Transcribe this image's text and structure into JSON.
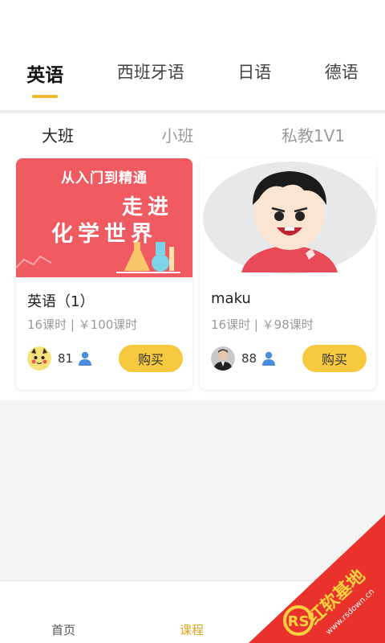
{
  "lang_tabs": [
    {
      "label": "英语",
      "active": true
    },
    {
      "label": "西班牙语",
      "active": false
    },
    {
      "label": "日语",
      "active": false
    },
    {
      "label": "德语",
      "active": false
    }
  ],
  "class_tabs": [
    {
      "label": "大班",
      "active": true
    },
    {
      "label": "小班",
      "active": false
    },
    {
      "label": "私教1V1",
      "active": false
    }
  ],
  "courses": [
    {
      "title": "英语（1）",
      "meta": "16课时 | ￥100课时",
      "count": "81",
      "buy_label": "购买",
      "thumb_lines": [
        "从入门到精通",
        "走进",
        "化学世界"
      ]
    },
    {
      "title": "maku",
      "meta": "16课时 | ￥98课时",
      "count": "88",
      "buy_label": "购买"
    }
  ],
  "bottom_nav": {
    "home": "首页",
    "course": "课程"
  },
  "watermark": {
    "brand": "红软基地",
    "url": "www.rsdown.cn"
  },
  "colors": {
    "accent": "#f2b92c",
    "buy_button": "#f7c93e",
    "active_nav": "#e0a426",
    "watermark_red": "#e8322b"
  }
}
